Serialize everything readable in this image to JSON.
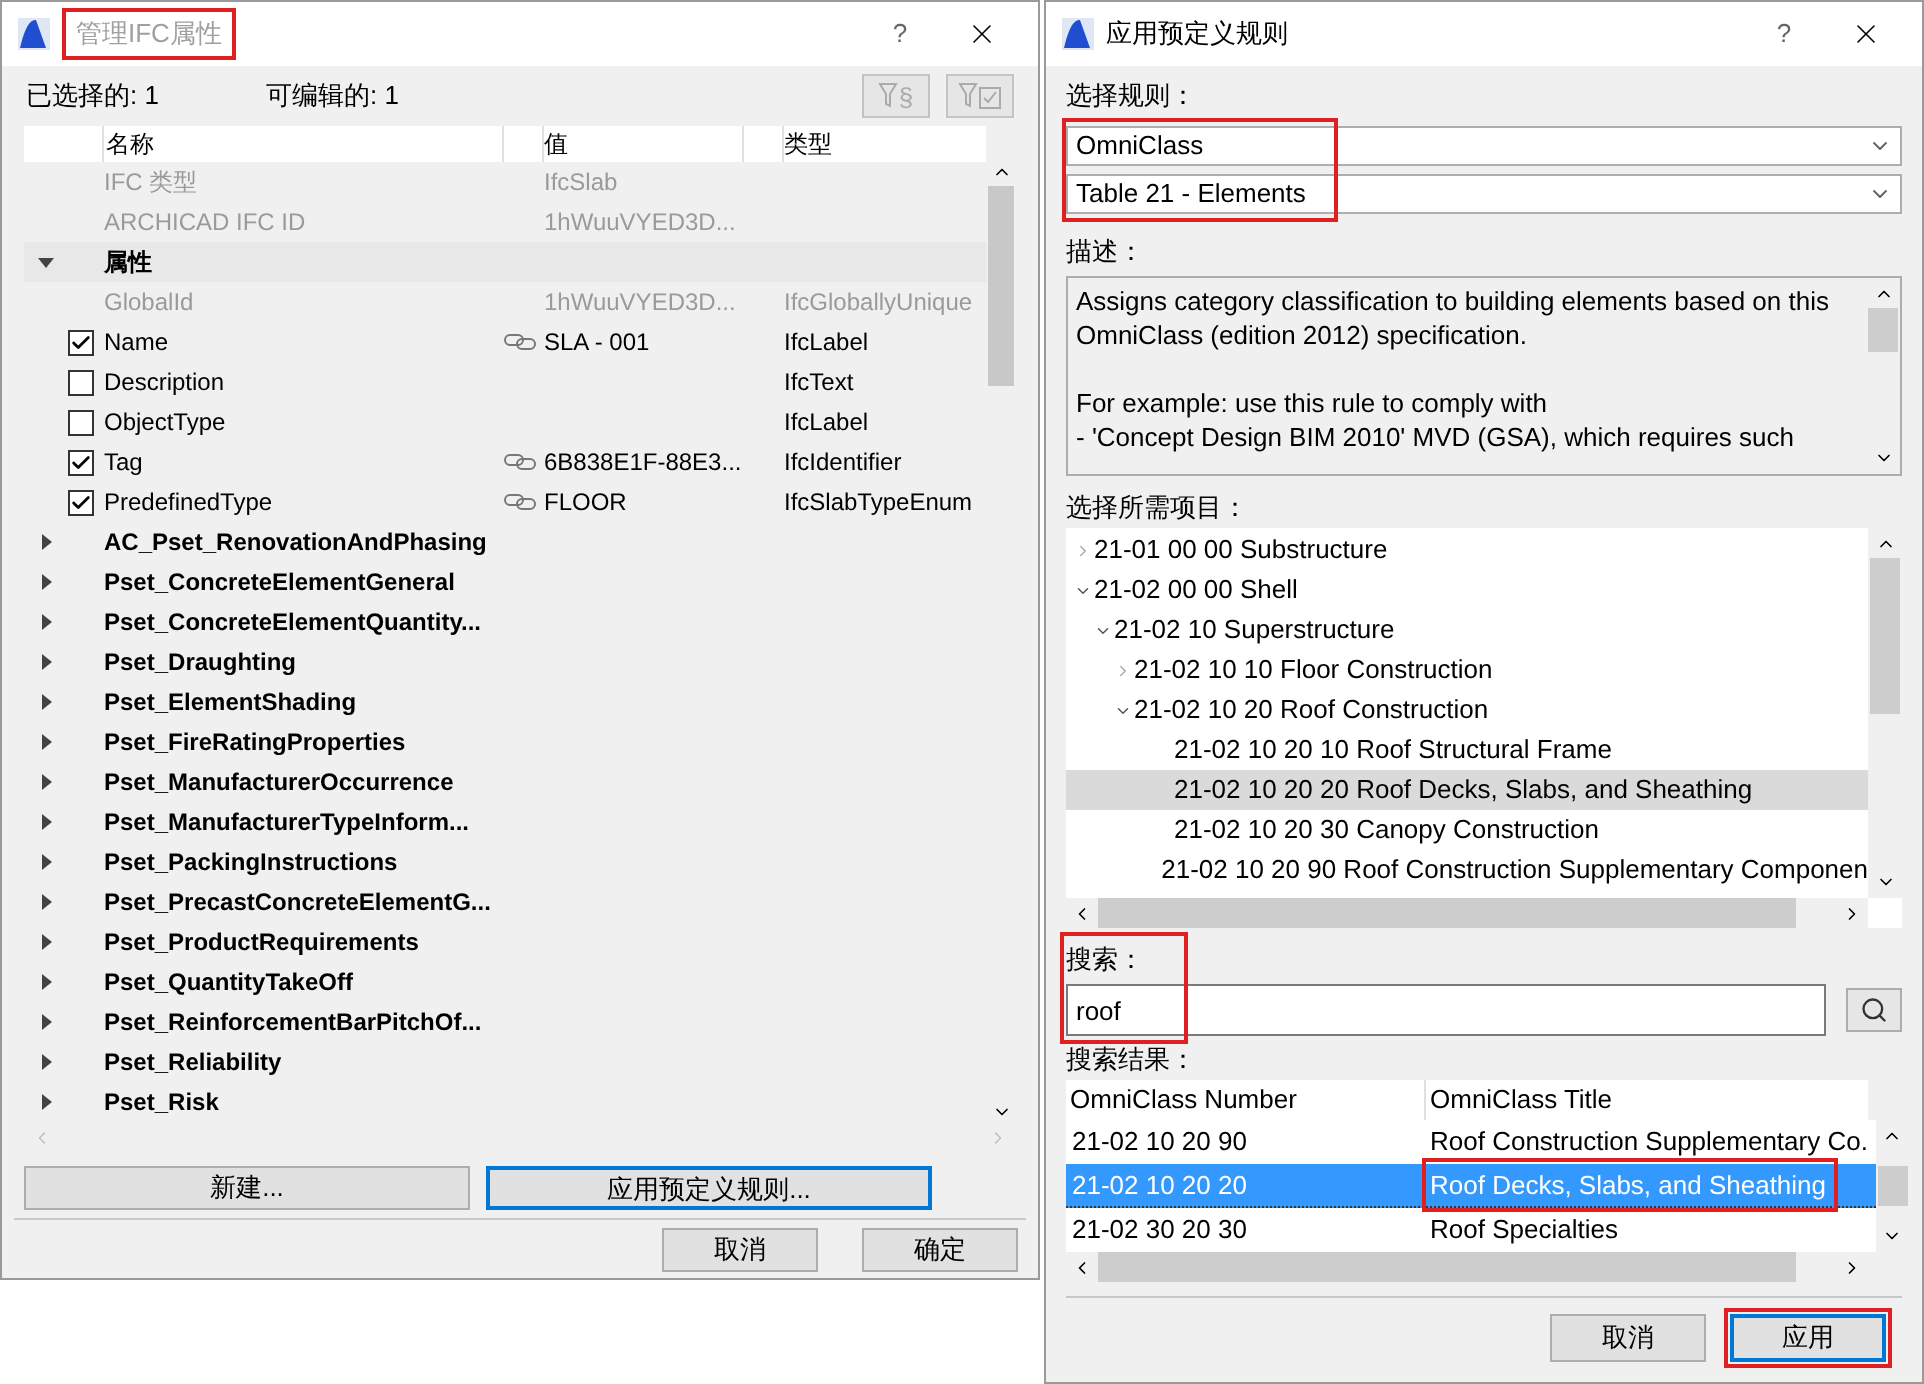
{
  "left_dialog": {
    "title": "管理IFC属性",
    "title_highlighted": true,
    "help": "?",
    "filter_symbol": "§",
    "selected_count": "已选择的: 1",
    "editable_count": "可编辑的: 1",
    "columns": [
      "名称",
      "值",
      "类型"
    ],
    "rows": [
      {
        "kind": "info",
        "name": "IFC 类型",
        "value": "IfcSlab"
      },
      {
        "kind": "info",
        "name": "ARCHICAD IFC ID",
        "value": "1hWuuVYED3D..."
      },
      {
        "kind": "group",
        "name": "属性",
        "expanded": true,
        "children": [
          {
            "kind": "info",
            "name": "GlobalId",
            "value": "1hWuuVYED3D...",
            "type": "IfcGloballyUnique"
          },
          {
            "kind": "property",
            "name": "Name",
            "checked": true,
            "linked": true,
            "value": "SLA - 001",
            "type": "IfcLabel"
          },
          {
            "kind": "property",
            "name": "Description",
            "checked": false,
            "linked": false,
            "type": "IfcText"
          },
          {
            "kind": "property",
            "name": "ObjectType",
            "checked": false,
            "linked": false,
            "type": "IfcLabel"
          },
          {
            "kind": "property",
            "name": "Tag",
            "checked": true,
            "linked": true,
            "value": "6B838E1F-88E3...",
            "type": "IfcIdentifier"
          },
          {
            "kind": "property",
            "name": "PredefinedType",
            "checked": true,
            "linked": true,
            "value": "FLOOR",
            "type": "IfcSlabTypeEnum"
          }
        ]
      },
      {
        "kind": "group",
        "name": "AC_Pset_RenovationAndPhasing",
        "expanded": false
      },
      {
        "kind": "group",
        "name": "Pset_ConcreteElementGeneral",
        "expanded": false
      },
      {
        "kind": "group",
        "name": "Pset_ConcreteElementQuantity...",
        "expanded": false
      },
      {
        "kind": "group",
        "name": "Pset_Draughting",
        "expanded": false
      },
      {
        "kind": "group",
        "name": "Pset_ElementShading",
        "expanded": false
      },
      {
        "kind": "group",
        "name": "Pset_FireRatingProperties",
        "expanded": false
      },
      {
        "kind": "group",
        "name": "Pset_ManufacturerOccurrence",
        "expanded": false
      },
      {
        "kind": "group",
        "name": "Pset_ManufacturerTypeInform...",
        "expanded": false
      },
      {
        "kind": "group",
        "name": "Pset_PackingInstructions",
        "expanded": false
      },
      {
        "kind": "group",
        "name": "Pset_PrecastConcreteElementG...",
        "expanded": false
      },
      {
        "kind": "group",
        "name": "Pset_ProductRequirements",
        "expanded": false
      },
      {
        "kind": "group",
        "name": "Pset_QuantityTakeOff",
        "expanded": false
      },
      {
        "kind": "group",
        "name": "Pset_ReinforcementBarPitchOf...",
        "expanded": false
      },
      {
        "kind": "group",
        "name": "Pset_Reliability",
        "expanded": false
      },
      {
        "kind": "group",
        "name": "Pset_Risk",
        "expanded": false
      }
    ],
    "action_buttons": [
      {
        "label": "新建...",
        "focused": false
      },
      {
        "label": "应用预定义规则...",
        "focused": true
      }
    ],
    "footer_buttons": [
      "取消",
      "确定"
    ]
  },
  "right_dialog": {
    "title": "应用预定义规则",
    "help": "?",
    "rule_label": "选择规则：",
    "rule_selects": [
      "OmniClass",
      "Table 21 - Elements"
    ],
    "rule_highlighted": true,
    "description_label": "描述：",
    "description": [
      "Assigns category classification to building elements based on this OmniClass (edition 2012) specification.",
      "For example: use this rule to comply with",
      "- 'Concept Design BIM 2010' MVD (GSA), which requires such"
    ],
    "items_label": "选择所需项目：",
    "tree": [
      {
        "label": "21-01 00 00 Substructure",
        "kind": "branch",
        "expanded": false,
        "selected": false
      },
      {
        "label": "21-02 00 00 Shell",
        "kind": "branch",
        "expanded": true,
        "selected": false,
        "children": [
          {
            "label": "21-02 10 Superstructure",
            "kind": "branch",
            "expanded": true,
            "selected": false,
            "children": [
              {
                "label": "21-02 10 10 Floor Construction",
                "kind": "branch",
                "expanded": false,
                "selected": false
              },
              {
                "label": "21-02 10 20 Roof Construction",
                "kind": "branch",
                "expanded": true,
                "selected": false,
                "children": [
                  {
                    "label": "21-02 10 20 10 Roof Structural Frame",
                    "kind": "leaf",
                    "selected": false
                  },
                  {
                    "label": "21-02 10 20 20 Roof Decks, Slabs, and Sheathing",
                    "kind": "leaf",
                    "selected": true
                  },
                  {
                    "label": "21-02 10 20 30 Canopy Construction",
                    "kind": "leaf",
                    "selected": false
                  },
                  {
                    "label": "21-02 10 20 90 Roof Construction Supplementary Componen",
                    "kind": "leaf",
                    "selected": false
                  }
                ]
              }
            ]
          }
        ]
      }
    ],
    "search_label": "搜索：",
    "search_value": "roof",
    "search_highlighted": true,
    "results_label": "搜索结果：",
    "results_columns": [
      "OmniClass Number",
      "OmniClass Title"
    ],
    "results": [
      {
        "number": "21-02 10 20 90",
        "title": "Roof Construction Supplementary Co.",
        "selected": false,
        "highlighted": false
      },
      {
        "number": "21-02 10 20 20",
        "title": "Roof Decks, Slabs, and Sheathing",
        "selected": true,
        "highlighted": true
      },
      {
        "number": "21-02 30 20 30",
        "title": "Roof Specialties",
        "selected": false,
        "highlighted": false
      }
    ],
    "buttons": [
      {
        "label": "取消",
        "highlighted": false
      },
      {
        "label": "应用",
        "highlighted": true
      }
    ]
  }
}
